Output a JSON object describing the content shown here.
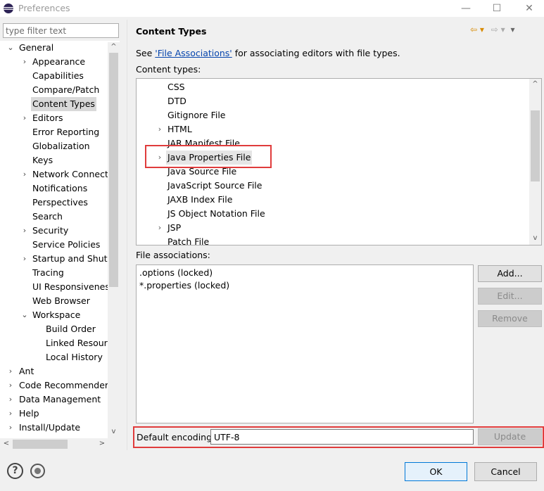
{
  "window": {
    "title": "Preferences",
    "minimize": "—",
    "maximize": "☐",
    "close": "✕"
  },
  "filter": {
    "placeholder": "type filter text"
  },
  "tree": {
    "items": [
      {
        "label": "General",
        "depth": 0,
        "chevron": "⌄"
      },
      {
        "label": "Appearance",
        "depth": 1,
        "chevron": "›"
      },
      {
        "label": "Capabilities",
        "depth": 1,
        "chevron": ""
      },
      {
        "label": "Compare/Patch",
        "depth": 1,
        "chevron": ""
      },
      {
        "label": "Content Types",
        "depth": 1,
        "chevron": "",
        "selected": true
      },
      {
        "label": "Editors",
        "depth": 1,
        "chevron": "›"
      },
      {
        "label": "Error Reporting",
        "depth": 1,
        "chevron": ""
      },
      {
        "label": "Globalization",
        "depth": 1,
        "chevron": ""
      },
      {
        "label": "Keys",
        "depth": 1,
        "chevron": ""
      },
      {
        "label": "Network Connectio",
        "depth": 1,
        "chevron": "›"
      },
      {
        "label": "Notifications",
        "depth": 1,
        "chevron": ""
      },
      {
        "label": "Perspectives",
        "depth": 1,
        "chevron": ""
      },
      {
        "label": "Search",
        "depth": 1,
        "chevron": ""
      },
      {
        "label": "Security",
        "depth": 1,
        "chevron": "›"
      },
      {
        "label": "Service Policies",
        "depth": 1,
        "chevron": ""
      },
      {
        "label": "Startup and Shutd",
        "depth": 1,
        "chevron": "›"
      },
      {
        "label": "Tracing",
        "depth": 1,
        "chevron": ""
      },
      {
        "label": "UI Responsiveness",
        "depth": 1,
        "chevron": ""
      },
      {
        "label": "Web Browser",
        "depth": 1,
        "chevron": ""
      },
      {
        "label": "Workspace",
        "depth": 1,
        "chevron": "⌄"
      },
      {
        "label": "Build Order",
        "depth": 2,
        "chevron": ""
      },
      {
        "label": "Linked Resourc",
        "depth": 2,
        "chevron": ""
      },
      {
        "label": "Local History",
        "depth": 2,
        "chevron": ""
      },
      {
        "label": "Ant",
        "depth": 0,
        "chevron": "›"
      },
      {
        "label": "Code Recommenders",
        "depth": 0,
        "chevron": "›"
      },
      {
        "label": "Data Management",
        "depth": 0,
        "chevron": "›"
      },
      {
        "label": "Help",
        "depth": 0,
        "chevron": "›"
      },
      {
        "label": "Install/Update",
        "depth": 0,
        "chevron": "›"
      }
    ],
    "scroll_up": "^",
    "scroll_down": "v",
    "scroll_left": "<",
    "scroll_right": ">"
  },
  "page": {
    "title": "Content Types",
    "nav_back": "⇦ ▾",
    "nav_forward": "⇨ ▾",
    "nav_menu": "▾",
    "see_prefix": "See ",
    "see_link": "'File Associations'",
    "see_suffix": " for associating editors with file types.",
    "content_types_label": "Content types:",
    "content_types": [
      {
        "label": "CSS",
        "chevron": ""
      },
      {
        "label": "DTD",
        "chevron": ""
      },
      {
        "label": "Gitignore File",
        "chevron": ""
      },
      {
        "label": "HTML",
        "chevron": "›"
      },
      {
        "label": "JAR Manifest File",
        "chevron": ""
      },
      {
        "label": "Java Properties File",
        "chevron": "›",
        "selected": true
      },
      {
        "label": "Java Source File",
        "chevron": ""
      },
      {
        "label": "JavaScript Source File",
        "chevron": ""
      },
      {
        "label": "JAXB Index File",
        "chevron": ""
      },
      {
        "label": "JS Object Notation File",
        "chevron": ""
      },
      {
        "label": "JSP",
        "chevron": "›"
      },
      {
        "label": "Patch File",
        "chevron": ""
      }
    ],
    "file_assoc_label": "File associations:",
    "file_associations": [
      ".options (locked)",
      "*.properties (locked)"
    ],
    "add_button": "Add...",
    "edit_button": "Edit...",
    "remove_button": "Remove",
    "encoding_label": "Default encoding:",
    "encoding_value": "UTF-8",
    "update_button": "Update"
  },
  "footer": {
    "help_glyph": "?",
    "ok_button": "OK",
    "cancel_button": "Cancel"
  }
}
